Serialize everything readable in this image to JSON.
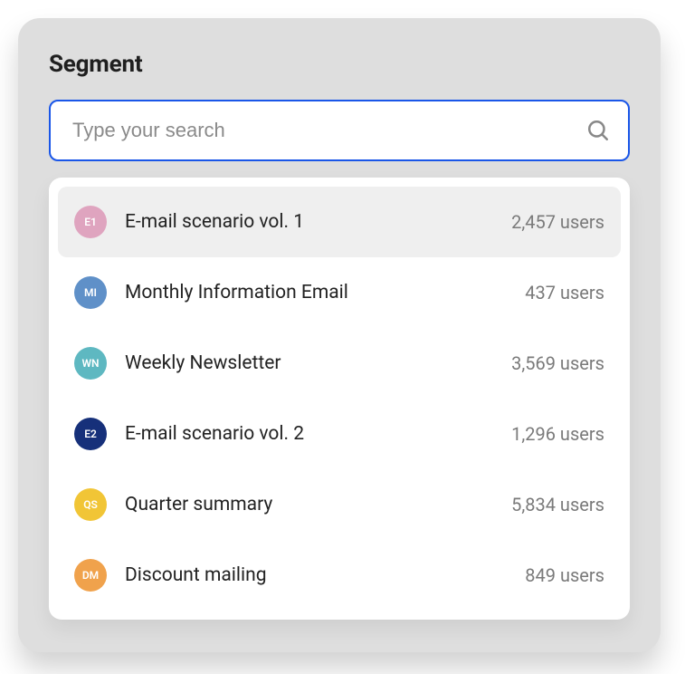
{
  "header": {
    "title": "Segment"
  },
  "search": {
    "placeholder": "Type your search",
    "value": ""
  },
  "items": [
    {
      "initials": "E1",
      "color": "#dfa4bf",
      "label": "E-mail scenario vol. 1",
      "meta": "2,457 users",
      "selected": true
    },
    {
      "initials": "MI",
      "color": "#5f90c8",
      "label": "Monthly Information Email",
      "meta": "437 users",
      "selected": false
    },
    {
      "initials": "WN",
      "color": "#5eb8c1",
      "label": "Weekly Newsletter",
      "meta": "3,569 users",
      "selected": false
    },
    {
      "initials": "E2",
      "color": "#16307a",
      "label": "E-mail scenario vol. 2",
      "meta": "1,296 users",
      "selected": false
    },
    {
      "initials": "QS",
      "color": "#f1c536",
      "label": "Quarter summary",
      "meta": "5,834 users",
      "selected": false
    },
    {
      "initials": "DM",
      "color": "#f0a24c",
      "label": "Discount mailing",
      "meta": "849 users",
      "selected": false
    }
  ]
}
